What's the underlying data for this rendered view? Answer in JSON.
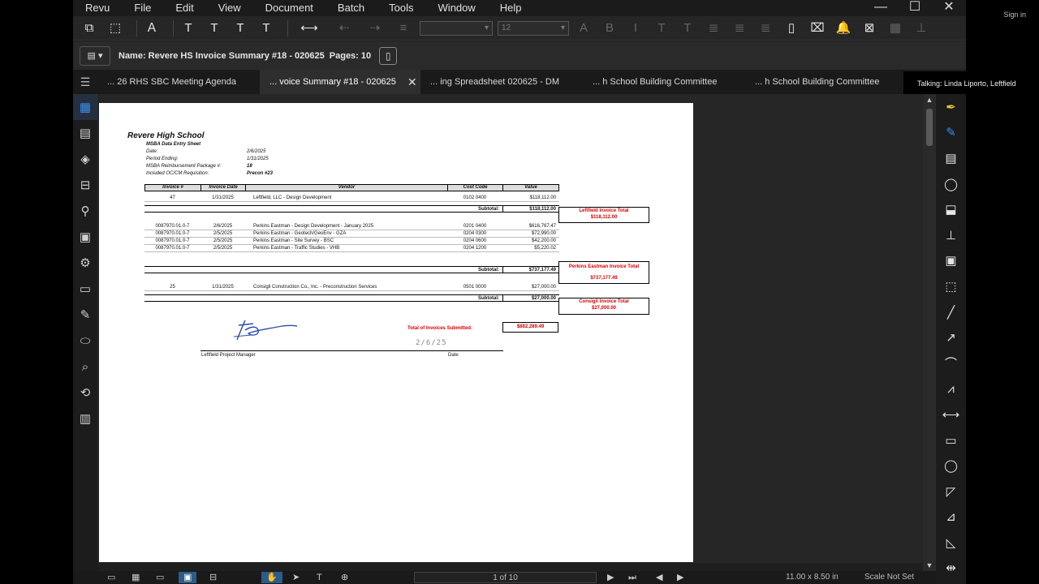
{
  "menu": [
    "Revu",
    "File",
    "Edit",
    "View",
    "Document",
    "Batch",
    "Tools",
    "Window",
    "Help"
  ],
  "window_controls": [
    "—",
    "☐",
    "✕"
  ],
  "signin_label": "Sign in",
  "talking": "Talking: Linda Liporto, Leftfield",
  "toolbar": {
    "font_size_value": "12",
    "font_family_value": ""
  },
  "properties": {
    "name": "Name: Revere HS Invoice Summary #18 - 020625",
    "pages": "Pages: 10"
  },
  "tabs": [
    {
      "label": "... 26 RHS SBC Meeting Agenda",
      "active": false
    },
    {
      "label": "... voice Summary #18 - 020625",
      "active": true
    },
    {
      "label": "... ing Spreadsheet 020625 - DM",
      "active": false
    },
    {
      "label": "... h School Building Committee",
      "active": false
    },
    {
      "label": "... h School Building Committee",
      "active": false
    }
  ],
  "document": {
    "title": "Revere High School",
    "subtitle": "MSBA Data Entry Sheet",
    "header_rows": [
      {
        "label": "Date:",
        "value": "2/6/2025"
      },
      {
        "label": "Period Ending:",
        "value": "1/31/2025"
      },
      {
        "label": "MSBA Reimbursement Package #:",
        "value": "18"
      },
      {
        "label": "Included OC/CM Requisition:",
        "value": "Precon #23"
      }
    ],
    "columns": [
      "Invoice #",
      "Invoice Date",
      "Vendor",
      "Cost Code",
      "Value"
    ],
    "groups": [
      {
        "rows": [
          {
            "invoice": "47",
            "date": "1/31/2025",
            "vendor": "Leftfield, LLC - Design Development",
            "code": "0102 0400",
            "value": "$118,112.00"
          }
        ],
        "subtotal_label": "Subtotal:",
        "subtotal": "$118,112.00",
        "box_title": "Leftfield Invoice Total",
        "box_value": "$118,112.00"
      },
      {
        "rows": [
          {
            "invoice": "0087970.01.0-7",
            "date": "2/6/2025",
            "vendor": "Perkins Eastman - Design Development - January 2025",
            "code": "0201 0400",
            "value": "$616,767.47"
          },
          {
            "invoice": "0087970.01.0-7",
            "date": "2/5/2025",
            "vendor": "Perkins Eastman - Geotech/GeoEnv - GZA",
            "code": "0204 0300",
            "value": "$72,990.00"
          },
          {
            "invoice": "0087970.01.0-7",
            "date": "2/5/2025",
            "vendor": "Perkins Eastman - Site Survey - BSC",
            "code": "0204 0600",
            "value": "$42,200.00"
          },
          {
            "invoice": "0087970.01.0-7",
            "date": "2/5/2025",
            "vendor": "Perkins Eastman - Traffic Studies - VHB",
            "code": "0204 1200",
            "value": "$5,220.02"
          }
        ],
        "subtotal_label": "Subtotal:",
        "subtotal": "$737,177.49",
        "box_title": "Perkins Eastman Invoice Total",
        "box_value": "$737,177.49"
      },
      {
        "rows": [
          {
            "invoice": "25",
            "date": "1/31/2025",
            "vendor": "Consigli Construction Co., Inc. - Preconstruction Services",
            "code": "0501 0000",
            "value": "$27,000.00"
          }
        ],
        "subtotal_label": "Subtotal:",
        "subtotal": "$27,000.00",
        "box_title": "Consigli Invoice Total",
        "box_value": "$27,000.00"
      }
    ],
    "grand_total_label": "Total of Invoices Submitted:",
    "grand_total": "$882,289.49",
    "signature_date": "2/6/25",
    "signature_label_pm": "Leftfield Project Manager",
    "signature_label_date": "Date"
  },
  "statusbar": {
    "page_indicator": "1 of 10",
    "dimensions": "11.00 x 8.50 in",
    "scale": "Scale Not Set"
  }
}
